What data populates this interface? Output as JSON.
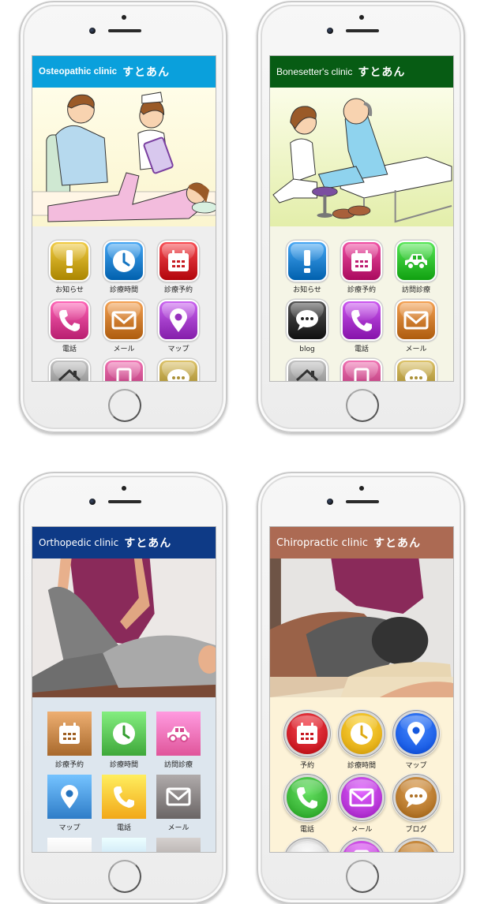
{
  "phones": [
    {
      "id": "osteopathic",
      "header": {
        "title_en": "Osteopathic clinic",
        "title_jp": "すとあん",
        "color": "#0aa0dc"
      },
      "hero": "illustration-doctor-nurse-patient-on-bed",
      "icon_style": "glossy-rounded-square",
      "menu": [
        {
          "label": "お知らせ",
          "icon": "exclamation-icon",
          "color": "#c9a41c"
        },
        {
          "label": "診療時間",
          "icon": "clock-icon",
          "color": "#1f7fcc"
        },
        {
          "label": "診療予約",
          "icon": "calendar-icon",
          "color": "#d0242a"
        },
        {
          "label": "電話",
          "icon": "phone-icon",
          "color": "#d63c8e"
        },
        {
          "label": "メール",
          "icon": "mail-icon",
          "color": "#cc7a2c"
        },
        {
          "label": "マップ",
          "icon": "map-pin-icon",
          "color": "#a23cc8"
        },
        {
          "label": "",
          "icon": "home-icon",
          "color": "#9a9a9a"
        },
        {
          "label": "",
          "icon": "mobile-icon",
          "color": "#c84a8a"
        },
        {
          "label": "",
          "icon": "chat-icon",
          "color": "#b49a40"
        }
      ]
    },
    {
      "id": "bonesetter",
      "header": {
        "title_en": "Bonesetter's clinic",
        "title_jp": "すとあん",
        "color": "#075c14"
      },
      "hero": "illustration-nurse-treating-elderly-man",
      "icon_style": "glossy-rounded-square",
      "menu": [
        {
          "label": "お知らせ",
          "icon": "exclamation-icon",
          "color": "#1f7fcc"
        },
        {
          "label": "診療予約",
          "icon": "calendar-icon",
          "color": "#c8287c"
        },
        {
          "label": "訪問診療",
          "icon": "car-icon",
          "color": "#2fbf2f"
        },
        {
          "label": "blog",
          "icon": "chat-icon",
          "color": "#2e2e2e"
        },
        {
          "label": "電話",
          "icon": "phone-icon",
          "color": "#a430c8"
        },
        {
          "label": "メール",
          "icon": "mail-icon",
          "color": "#cc7a2c"
        },
        {
          "label": "",
          "icon": "home-icon",
          "color": "#9a9a9a"
        },
        {
          "label": "",
          "icon": "mobile-icon",
          "color": "#c84a8a"
        },
        {
          "label": "",
          "icon": "chat-icon",
          "color": "#b49a40"
        }
      ]
    },
    {
      "id": "orthopedic",
      "header": {
        "title_en": "Orthopedic clinic",
        "title_jp": "すとあん",
        "color": "#0e3a86"
      },
      "hero": "photo-therapist-stretching-patient-leg",
      "icon_style": "flat-gradient-square",
      "menu": [
        {
          "label": "診療予約",
          "icon": "calendar-icon",
          "color": "#a8692c"
        },
        {
          "label": "診療時間",
          "icon": "clock-icon",
          "color": "#3ea83a"
        },
        {
          "label": "訪問診療",
          "icon": "car-icon",
          "color": "#e0559a"
        },
        {
          "label": "マップ",
          "icon": "map-pin-icon",
          "color": "#2f7dc8"
        },
        {
          "label": "電話",
          "icon": "phone-icon",
          "color": "#f2a818"
        },
        {
          "label": "メール",
          "icon": "mail-icon",
          "color": "#6a6565"
        },
        {
          "label": "",
          "icon": "tag-icon",
          "color": "#d8d8d8"
        },
        {
          "label": "",
          "icon": "shoe-icon",
          "color": "#a6c4e8"
        },
        {
          "label": "",
          "icon": "crown-icon",
          "color": "#8f8a88"
        }
      ]
    },
    {
      "id": "chiropractic",
      "header": {
        "title_en": "Chiropractic clinic",
        "title_jp": "すとあん",
        "color": "#ac6a53"
      },
      "hero": "photo-therapist-massaging-back",
      "icon_style": "round-metallic",
      "menu": [
        {
          "label": "予約",
          "icon": "calendar-icon",
          "color": "#d0202a"
        },
        {
          "label": "診療時間",
          "icon": "clock-icon",
          "color": "#e8b41c"
        },
        {
          "label": "マップ",
          "icon": "map-pin-icon",
          "color": "#1f62e8"
        },
        {
          "label": "電話",
          "icon": "phone-icon",
          "color": "#3db83a"
        },
        {
          "label": "メール",
          "icon": "mail-icon",
          "color": "#b838d8"
        },
        {
          "label": "ブログ",
          "icon": "chat-icon",
          "color": "#b87a2e"
        },
        {
          "label": "",
          "icon": "user-icon",
          "color": "#dcdcdc"
        },
        {
          "label": "",
          "icon": "mobile-icon",
          "color": "#c040d8"
        },
        {
          "label": "",
          "icon": "camera-icon",
          "color": "#b87a2e"
        }
      ]
    }
  ]
}
